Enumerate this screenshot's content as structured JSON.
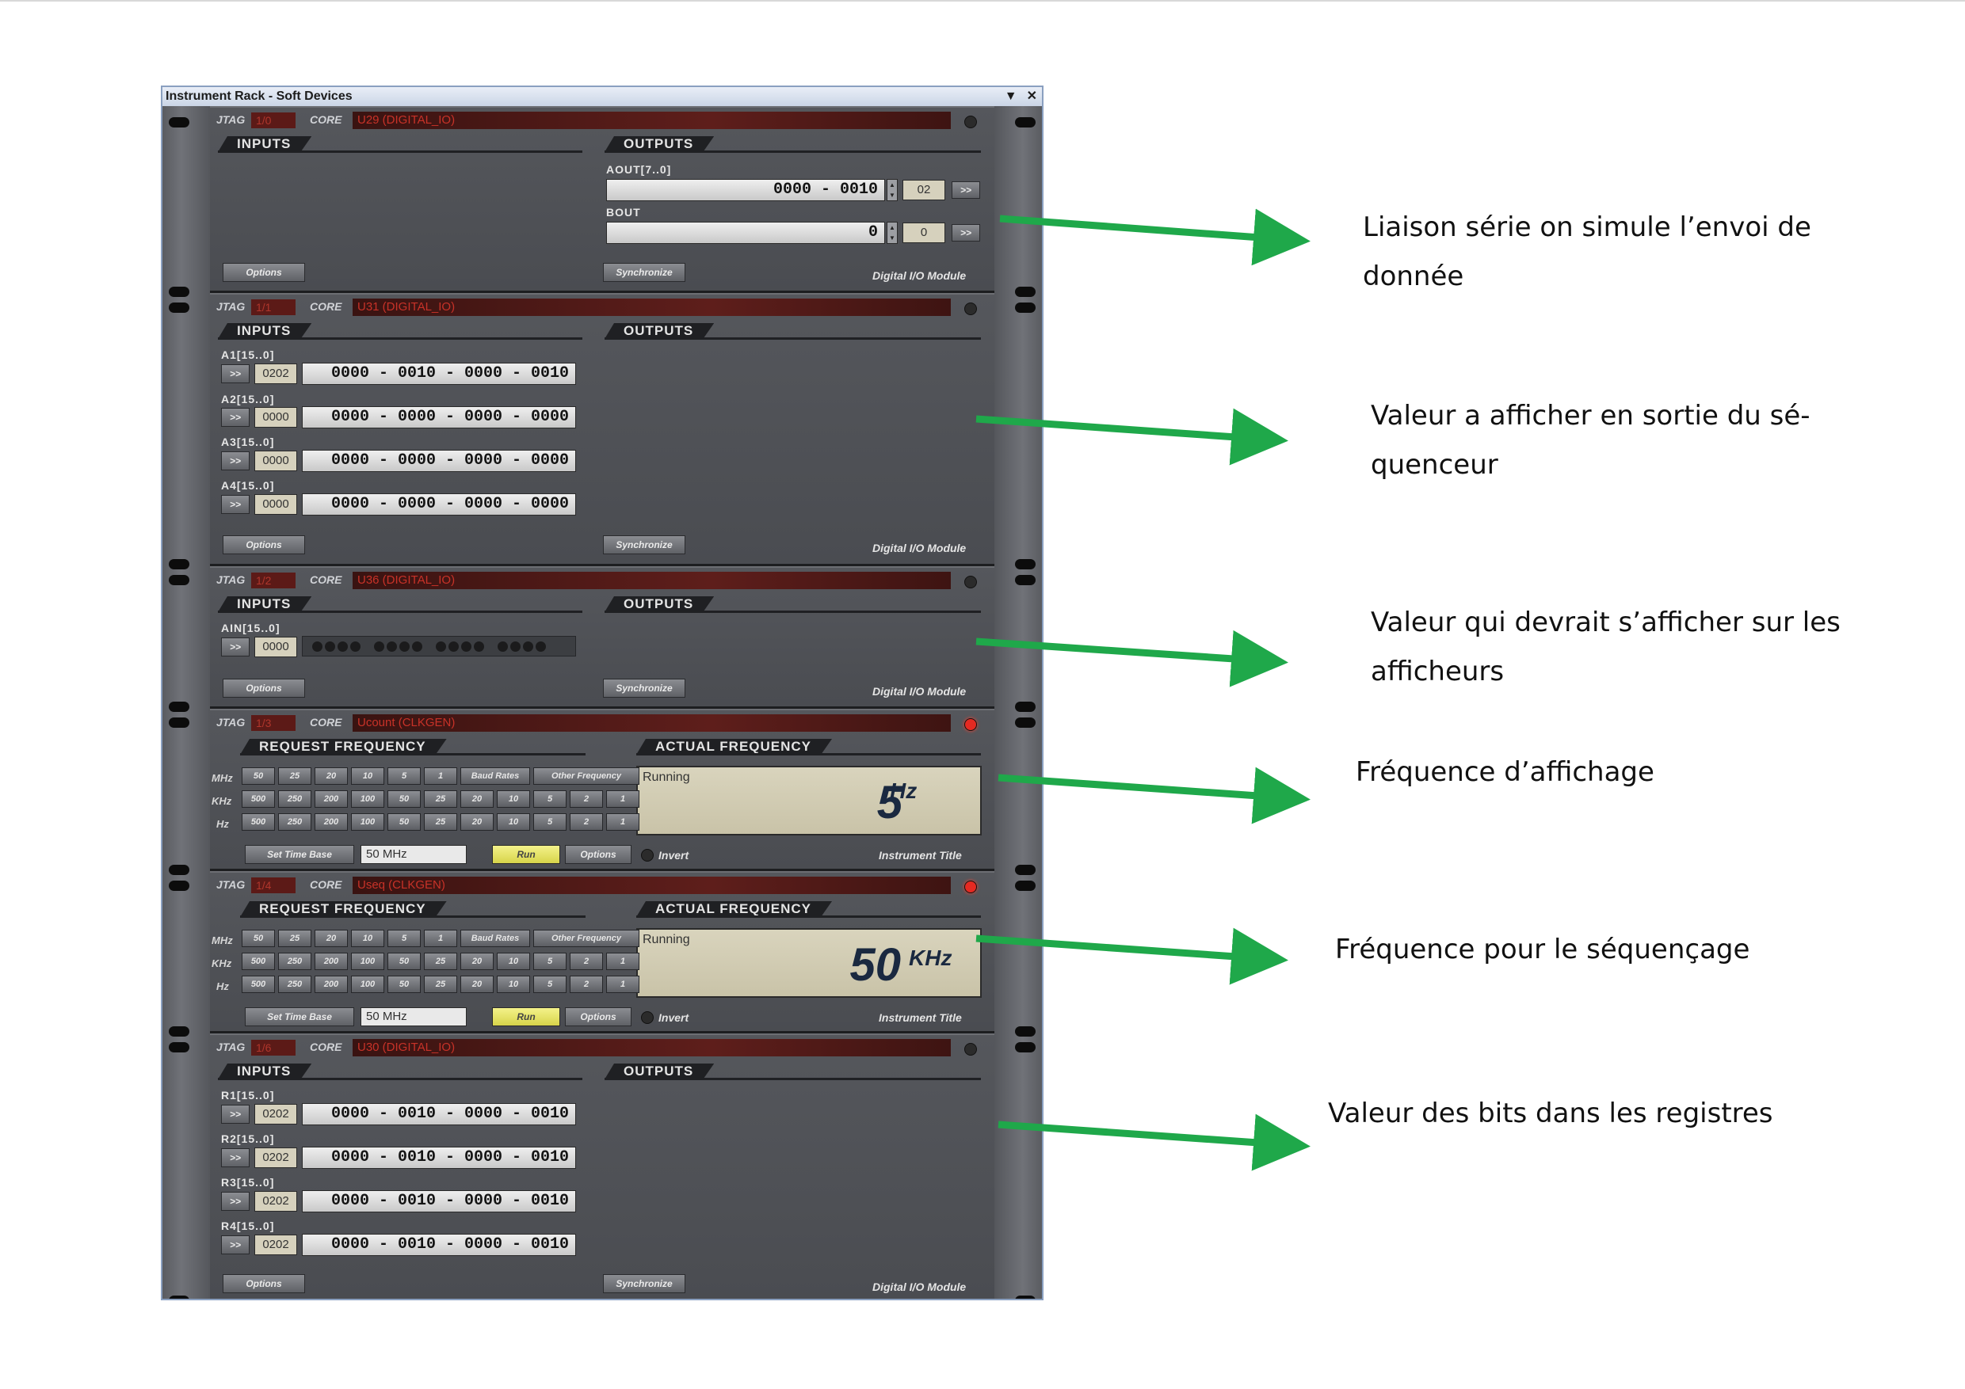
{
  "window": {
    "title": "Instrument Rack - Soft Devices",
    "menu_icon": "▼",
    "close_icon": "✕"
  },
  "common": {
    "jtag_label": "JTAG",
    "core_label": "CORE",
    "inputs": "INPUTS",
    "outputs": "OUTPUTS",
    "options": "Options",
    "synchronize": "Synchronize",
    "dio_title": "Digital I/O Module",
    "push": ">>",
    "req_freq": "REQUEST FREQUENCY",
    "act_freq": "ACTUAL FREQUENCY",
    "mhz": "MHz",
    "khz": "KHz",
    "hz": "Hz",
    "baud": "Baud Rates",
    "other": "Other Frequency",
    "set_time_base": "Set Time Base",
    "run": "Run",
    "invert": "Invert",
    "instrument_title": "Instrument Title",
    "running": "Running"
  },
  "freq_rows": {
    "mhz": [
      "50",
      "25",
      "20",
      "10",
      "5",
      "1"
    ],
    "khz": [
      "500",
      "250",
      "200",
      "100",
      "50",
      "25",
      "20",
      "10",
      "5",
      "2",
      "1"
    ],
    "hz": [
      "500",
      "250",
      "200",
      "100",
      "50",
      "25",
      "20",
      "10",
      "5",
      "2",
      "1"
    ]
  },
  "modules": [
    {
      "jtag": "1/0",
      "core": "U29 (DIGITAL_IO)",
      "led_on": false,
      "outputs": [
        {
          "label": "AOUT[7..0]",
          "value": "0000 - 0010",
          "hex": "02"
        },
        {
          "label": "BOUT",
          "value": "0",
          "hex": "0"
        }
      ]
    },
    {
      "jtag": "1/1",
      "core": "U31 (DIGITAL_IO)",
      "led_on": false,
      "inputs": [
        {
          "label": "A1[15..0]",
          "hex": "0202",
          "value": "0000 - 0010 - 0000 - 0010"
        },
        {
          "label": "A2[15..0]",
          "hex": "0000",
          "value": "0000 - 0000 - 0000 - 0000"
        },
        {
          "label": "A3[15..0]",
          "hex": "0000",
          "value": "0000 - 0000 - 0000 - 0000"
        },
        {
          "label": "A4[15..0]",
          "hex": "0000",
          "value": "0000 - 0000 - 0000 - 0000"
        }
      ]
    },
    {
      "jtag": "1/2",
      "core": "U36 (DIGITAL_IO)",
      "led_on": false,
      "inputs": [
        {
          "label": "AIN[15..0]",
          "hex": "0000"
        }
      ]
    },
    {
      "jtag": "1/3",
      "core": "Ucount (CLKGEN)",
      "led_on": true,
      "time_base": "50 MHz",
      "freq_value": "5",
      "freq_unit": "Hz"
    },
    {
      "jtag": "1/4",
      "core": "Useq (CLKGEN)",
      "led_on": true,
      "time_base": "50 MHz",
      "freq_value": "50",
      "freq_unit": "KHz"
    },
    {
      "jtag": "1/6",
      "core": "U30 (DIGITAL_IO)",
      "led_on": false,
      "inputs": [
        {
          "label": "R1[15..0]",
          "hex": "0202",
          "value": "0000 - 0010 - 0000 - 0010"
        },
        {
          "label": "R2[15..0]",
          "hex": "0202",
          "value": "0000 - 0010 - 0000 - 0010"
        },
        {
          "label": "R3[15..0]",
          "hex": "0202",
          "value": "0000 - 0010 - 0000 - 0010"
        },
        {
          "label": "R4[15..0]",
          "hex": "0202",
          "value": "0000 - 0010 - 0000 - 0010"
        }
      ]
    }
  ],
  "annotations": [
    {
      "lines": [
        "Liaison série on simule l’envoi de",
        "donnée"
      ],
      "color": "#1fa84a"
    },
    {
      "lines": [
        "Valeur a afficher en sortie du sé-",
        "quenceur"
      ],
      "color": "#1fa84a"
    },
    {
      "lines": [
        "Valeur qui devrait s’afficher sur les",
        "afficheurs"
      ],
      "color": "#1fa84a"
    },
    {
      "lines": [
        "Fréquence d’affichage"
      ],
      "color": "#1fa84a"
    },
    {
      "lines": [
        "Fréquence pour le séquençage"
      ],
      "color": "#1fa84a"
    },
    {
      "lines": [
        "Valeur des bits dans les registres"
      ],
      "color": "#1fa84a"
    }
  ]
}
